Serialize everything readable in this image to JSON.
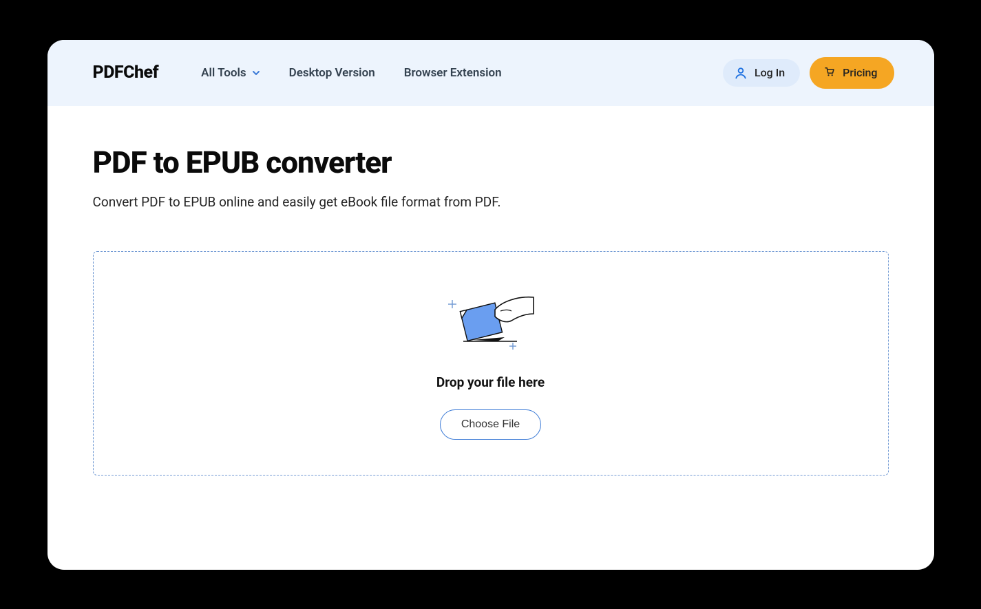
{
  "header": {
    "logo": "PDFChef",
    "nav": {
      "all_tools": "All Tools",
      "desktop_version": "Desktop Version",
      "browser_extension": "Browser Extension"
    },
    "login_label": "Log In",
    "pricing_label": "Pricing"
  },
  "main": {
    "title": "PDF to EPUB converter",
    "subtitle": "Convert PDF to EPUB online and easily get eBook file format from PDF.",
    "dropzone": {
      "drop_text": "Drop your file here",
      "choose_file_label": "Choose File"
    }
  }
}
